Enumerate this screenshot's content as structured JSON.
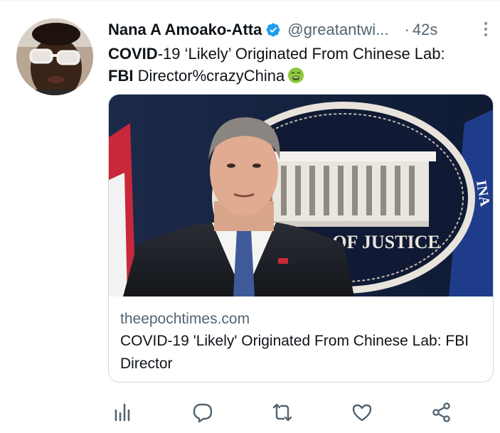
{
  "tweet": {
    "author_name": "Nana A Amoako-Atta",
    "handle": "@greatantwi...",
    "separator": "·",
    "time": "42s",
    "text_part1_bold": "COVID",
    "text_part2": "-19 ‘Likely’ Originated From Chinese Lab: ",
    "text_part3_bold": "FBI",
    "text_part4": " Director%crazyChina",
    "emoji": "nauseated-face-emoji"
  },
  "card": {
    "image_sign_text": "OF JUSTICE",
    "image_side_text": "INA",
    "domain": "theepochtimes.com",
    "title": "COVID-19 'Likely' Originated From Chinese Lab: FBI Director"
  },
  "actions": [
    {
      "name": "views-icon"
    },
    {
      "name": "reply-icon"
    },
    {
      "name": "retweet-icon"
    },
    {
      "name": "like-icon"
    },
    {
      "name": "share-icon"
    }
  ],
  "colors": {
    "text_primary": "#0f1419",
    "text_secondary": "#536471",
    "verified": "#1d9bf0",
    "border": "#cfd9de",
    "action_icon": "#536471"
  }
}
